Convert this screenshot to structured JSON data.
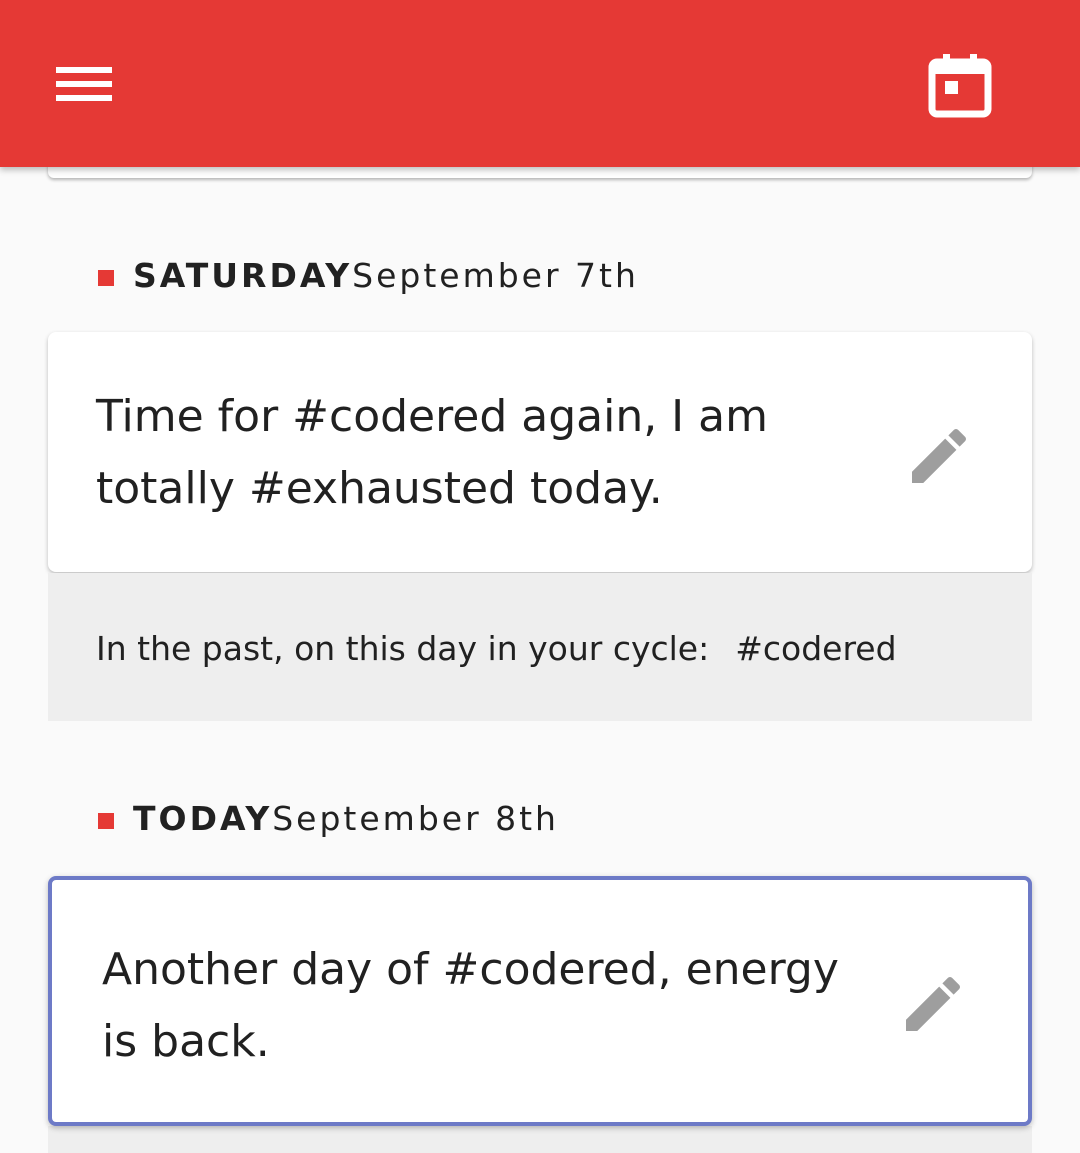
{
  "app_bar": {
    "background": "#e53935",
    "menu_icon": "menu-icon",
    "calendar_icon": "calendar-today-icon"
  },
  "days": [
    {
      "name": "SATURDAY",
      "date": "September 7th",
      "entry": {
        "text_line1": "Time for #codered again, I am",
        "text_line2": "totally #exhausted today.",
        "edit_icon": "pencil-icon"
      },
      "past": {
        "label": "In the past, on this day in your cycle:",
        "tag": "#codered"
      }
    },
    {
      "name": "TODAY",
      "date": "September 8th",
      "entry": {
        "text_line1": "Another day of #codered, energy",
        "text_line2": "is back.",
        "edit_icon": "pencil-icon"
      }
    }
  ],
  "colors": {
    "accent": "#e53935",
    "today_border": "#6d7ac7",
    "past_panel": "#eeeeee",
    "edit_icon": "#9e9e9e"
  }
}
